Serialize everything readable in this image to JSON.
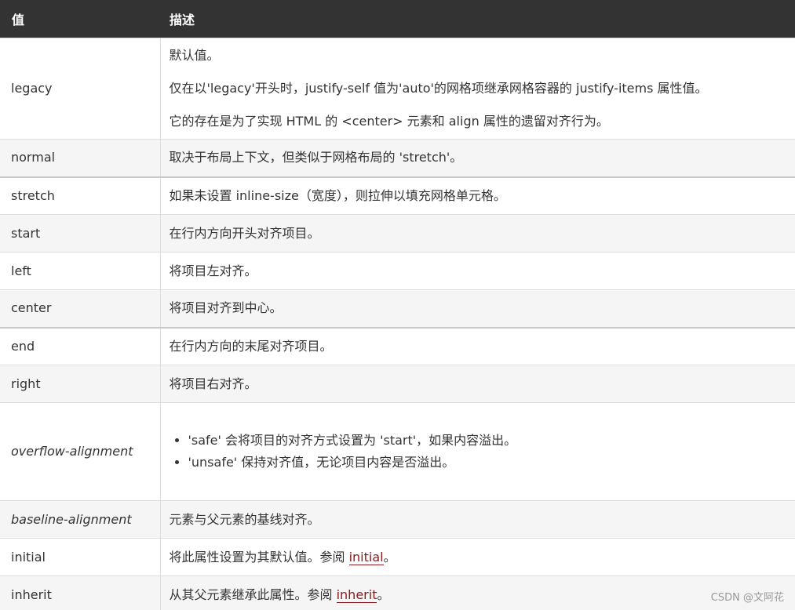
{
  "header": {
    "col_value": "值",
    "col_desc": "描述"
  },
  "rows": [
    {
      "value": "legacy",
      "desc": [
        "默认值。",
        "仅在以'legacy'开头时，justify-self 值为'auto'的网格项继承网格容器的 justify-items 属性值。",
        "它的存在是为了实现 HTML 的 <center> 元素和 align 属性的遗留对齐行为。"
      ]
    },
    {
      "value": "normal",
      "desc": "取决于布局上下文，但类似于网格布局的 'stretch'。"
    },
    {
      "value": "stretch",
      "desc": "如果未设置 inline-size（宽度），则拉伸以填充网格单元格。"
    },
    {
      "value": "start",
      "desc": "在行内方向开头对齐项目。"
    },
    {
      "value": "left",
      "desc": "将项目左对齐。"
    },
    {
      "value": "center",
      "desc": "将项目对齐到中心。"
    },
    {
      "value": "end",
      "desc": "在行内方向的末尾对齐项目。"
    },
    {
      "value": "right",
      "desc": "将项目右对齐。"
    },
    {
      "value": "overflow-alignment",
      "desc": [
        "'safe' 会将项目的对齐方式设置为 'start'，如果内容溢出。",
        "'unsafe' 保持对齐值，无论项目内容是否溢出。"
      ]
    },
    {
      "value": "baseline-alignment",
      "desc": "元素与父元素的基线对齐。"
    },
    {
      "value": "initial",
      "desc_prefix": "将此属性设置为其默认值。参阅 ",
      "link": "initial",
      "desc_suffix": "。"
    },
    {
      "value": "inherit",
      "desc_prefix": "从其父元素继承此属性。参阅 ",
      "link": "inherit",
      "desc_suffix": "。"
    }
  ],
  "watermark": "CSDN @文阿花",
  "colors": {
    "header_bg": "#333333",
    "stripe": "#f5f5f5",
    "link": "#8b1a1a"
  }
}
